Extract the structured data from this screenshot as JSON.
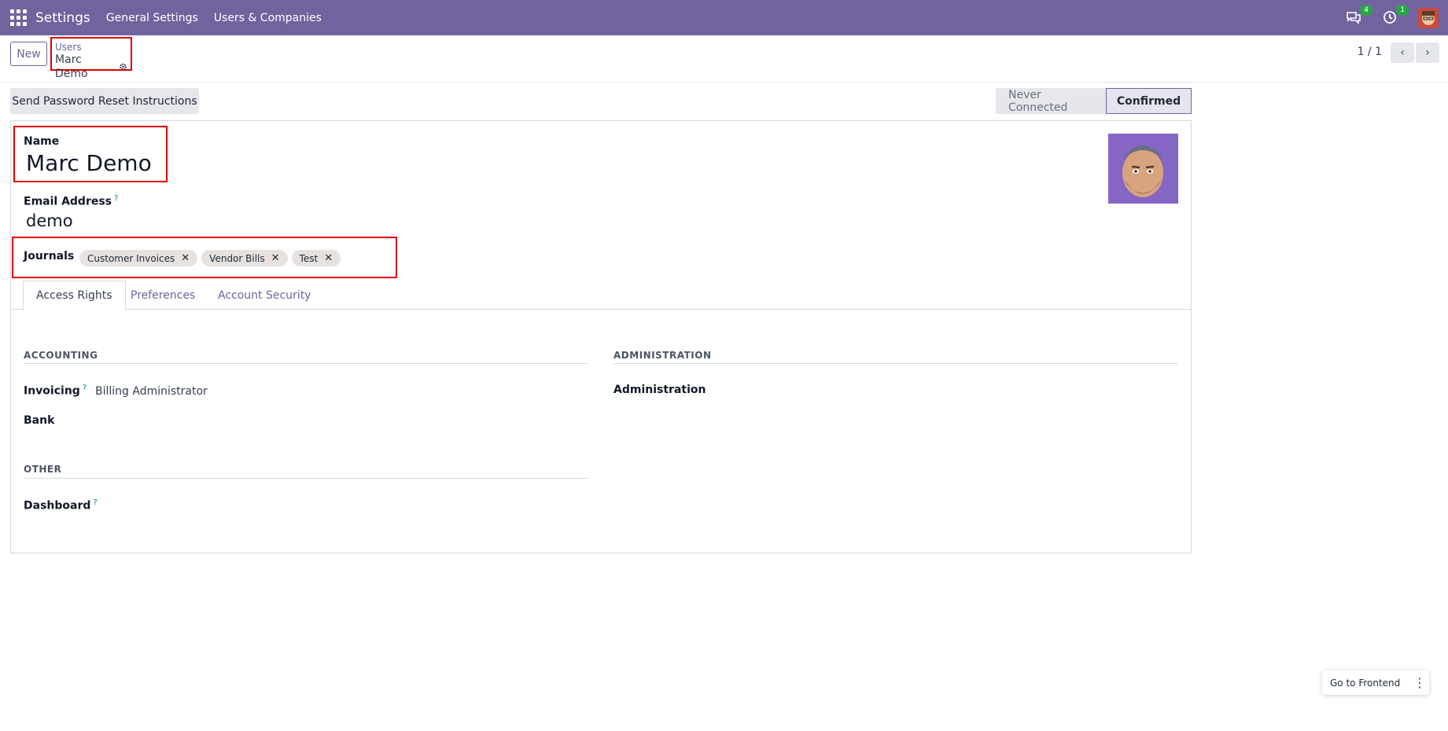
{
  "navbar": {
    "app_name": "Settings",
    "menu": [
      "General Settings",
      "Users & Companies"
    ],
    "messages_badge": "4",
    "activities_badge": "1"
  },
  "control_panel": {
    "new_label": "New",
    "breadcrumb_parent": "Users",
    "breadcrumb_current": "Marc Demo",
    "pager": "1 / 1"
  },
  "status": {
    "reset_button": "Send Password Reset Instructions",
    "stages": [
      "Never Connected",
      "Confirmed"
    ],
    "active_stage": "Confirmed"
  },
  "form": {
    "name_label": "Name",
    "name_value": "Marc Demo",
    "email_label": "Email Address",
    "email_help": "?",
    "email_value": "demo",
    "journals_label": "Journals",
    "journals": [
      "Customer Invoices",
      "Vendor Bills",
      "Test"
    ]
  },
  "tabs": [
    "Access Rights",
    "Preferences",
    "Account Security"
  ],
  "access_rights": {
    "accounting_title": "ACCOUNTING",
    "invoicing_label": "Invoicing",
    "invoicing_help": "?",
    "invoicing_value": "Billing Administrator",
    "bank_label": "Bank",
    "other_title": "OTHER",
    "dashboard_label": "Dashboard",
    "dashboard_help": "?",
    "administration_title": "ADMINISTRATION",
    "administration_label": "Administration"
  },
  "floating": {
    "go_frontend": "Go to Frontend"
  },
  "colors": {
    "brand": "#71639e",
    "highlight_box": "#e00000",
    "badge": "#28a745"
  }
}
